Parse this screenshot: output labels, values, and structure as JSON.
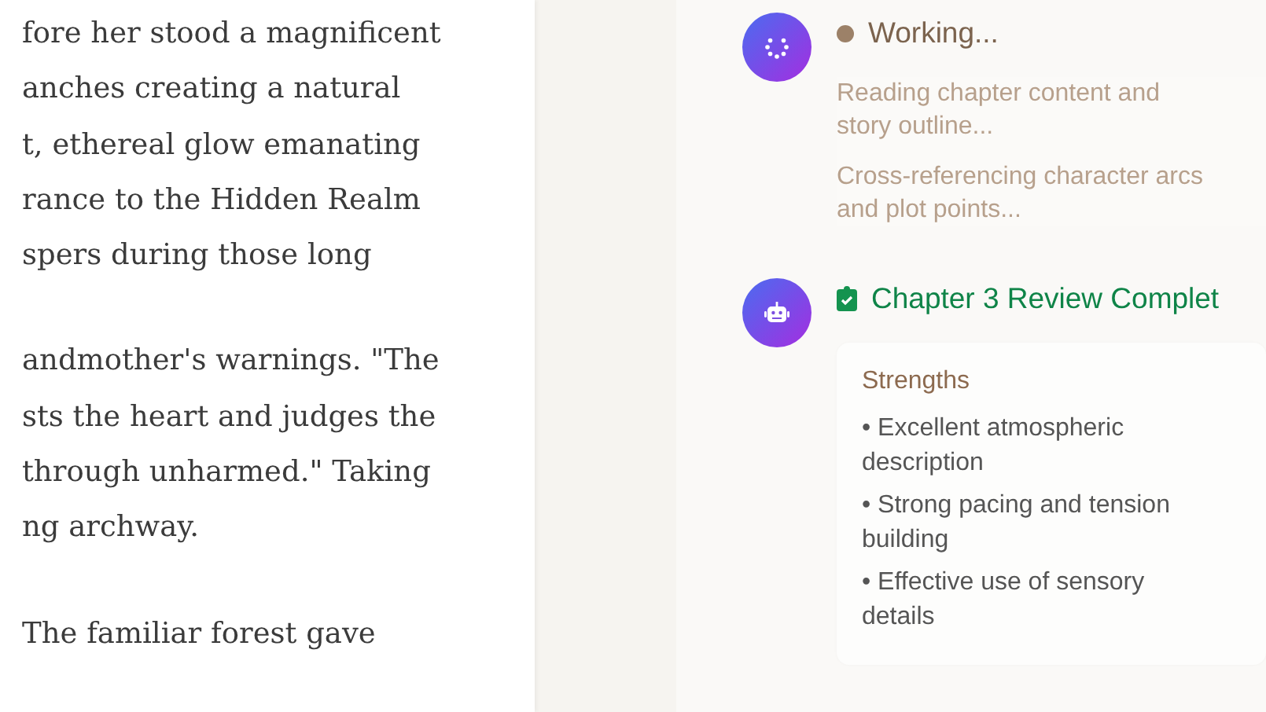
{
  "manuscript": {
    "paragraphs": [
      {
        "lines": [
          "fore her stood a magnificent",
          "anches creating a natural",
          "t, ethereal glow emanating",
          "rance to the Hidden Realm",
          "spers during those long"
        ]
      },
      {
        "lines": [
          "andmother's warnings. \"The",
          "sts the heart and judges the",
          "through unharmed.\" Taking",
          "ng archway."
        ]
      },
      {
        "lines": [
          "The familiar forest gave"
        ]
      }
    ]
  },
  "assistant": {
    "messages": [
      {
        "kind": "working",
        "title": "Working...",
        "steps": [
          "Reading chapter content and story outline...",
          "Cross-referencing character arcs and plot points..."
        ]
      },
      {
        "kind": "complete",
        "title": "Chapter 3 Review Complet",
        "section": "Strengths",
        "bullets": [
          "• Excellent atmospheric description",
          "• Strong pacing and tension building",
          "• Effective use of sensory details"
        ]
      }
    ]
  }
}
